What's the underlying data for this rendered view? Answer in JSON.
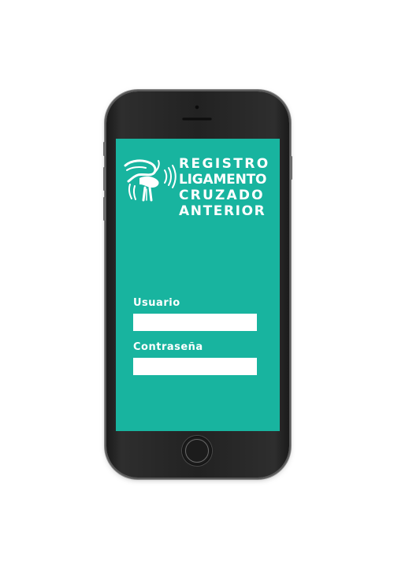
{
  "app": {
    "logo_lines": [
      "REGISTRO",
      "LIGAMENTO",
      "CRUZADO",
      "ANTERIOR"
    ],
    "logo_icon": "knee-joint-icon"
  },
  "login_form": {
    "username_label": "Usuario",
    "username_value": "",
    "password_label": "Contraseña",
    "password_value": ""
  },
  "colors": {
    "screen_background": "#18b49f",
    "phone_body": "#222222",
    "text": "#ffffff",
    "input_background": "#ffffff"
  }
}
